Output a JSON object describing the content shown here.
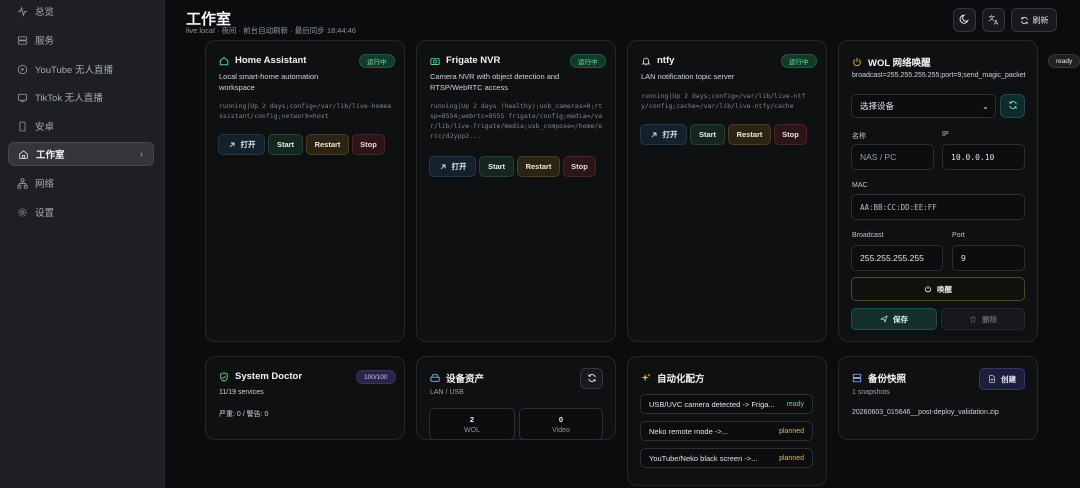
{
  "sidebar": {
    "items": [
      {
        "label": "总览",
        "icon": "activity-icon"
      },
      {
        "label": "服务",
        "icon": "server-icon"
      },
      {
        "label": "YouTube 无人直播",
        "icon": "play-circle-icon"
      },
      {
        "label": "TikTok 无人直播",
        "icon": "tv-icon"
      },
      {
        "label": "安卓",
        "icon": "phone-icon"
      },
      {
        "label": "工作室",
        "icon": "home-icon",
        "active": true
      },
      {
        "label": "网络",
        "icon": "network-icon"
      },
      {
        "label": "设置",
        "icon": "gear-icon"
      }
    ]
  },
  "header": {
    "title": "工作室",
    "subtitle": "live.local · 夜间 · 前台自动刷新 · 最后同步 18:44:46",
    "refresh_label": "刷新"
  },
  "services": [
    {
      "title": "Home Assistant",
      "status": "运行中",
      "desc": "Local smart-home automation workspace",
      "detail": "running|Up 2 days;config=/var/lib/live-homeassistant/config;network=host"
    },
    {
      "title": "Frigate NVR",
      "status": "运行中",
      "desc": "Camera NVR with object detection and RTSP/WebRTC access",
      "detail": "running|Up 2 days (healthy);usb_cameras=0;rtsp=8554;webrtc=8555 frigate/config;media=/var/lib/live-frigate/media;usb_compose=/home/eric/d2ypp2..."
    },
    {
      "title": "ntfy",
      "status": "运行中",
      "desc": "LAN notification topic server",
      "detail": "running|Up 2 days;config=/var/lib/live-ntfy/config;cache=/var/lib/live-ntfy/cache"
    }
  ],
  "service_buttons": {
    "open": "打开",
    "start": "Start",
    "restart": "Restart",
    "stop": "Stop"
  },
  "wol": {
    "title": "WOL 网络唤醒",
    "status": "ready",
    "info": "broadcast=255.255.255.255;port=9;send_magic_packet",
    "device_select": "选择设备",
    "name_label": "名称",
    "name_placeholder": "NAS / PC",
    "ip_label": "IP",
    "ip_value": "10.0.0.10",
    "mac_label": "MAC",
    "mac_value": "AA:BB:CC:DD:EE:FF",
    "broadcast_label": "Broadcast",
    "broadcast_value": "255.255.255.255",
    "port_label": "Port",
    "port_value": "9",
    "wake_label": "唤醒",
    "save_label": "保存",
    "delete_label": "删除"
  },
  "doctor": {
    "title": "System Doctor",
    "score": "100/100",
    "services": "11/19 services",
    "issues": "严重: 0 / 警告: 0"
  },
  "assets": {
    "title": "设备资产",
    "subtitle": "LAN / USB",
    "wol_count": "2",
    "wol_label": "WOL",
    "video_count": "0",
    "video_label": "Video"
  },
  "automation": {
    "title": "自动化配方",
    "recipes": [
      {
        "name": "USB/UVC camera detected -> Friga...",
        "status": "ready"
      },
      {
        "name": "Neko remote mode ->...",
        "status": "planned"
      },
      {
        "name": "YouTube/Neko black screen ->...",
        "status": "planned"
      }
    ]
  },
  "backup": {
    "title": "备份快照",
    "count": "1 snapshots",
    "create_label": "创建",
    "file": "20260603_015646__post-deploy_validation.zip"
  },
  "colors": {
    "running": "#6fe0a6",
    "ready": "#5fd494",
    "planned": "#e0b84a",
    "wol_accent": "#e0a43a"
  }
}
